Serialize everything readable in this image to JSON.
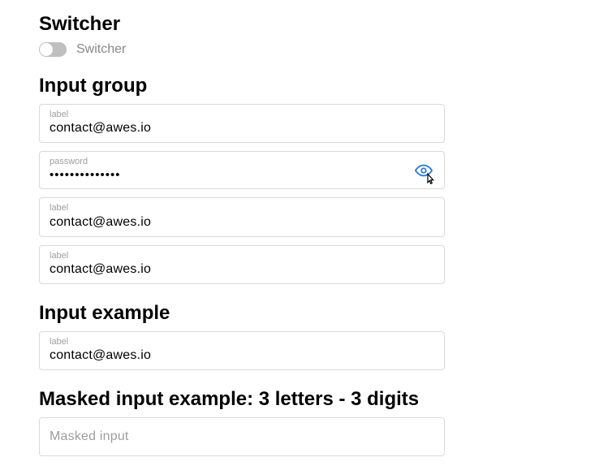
{
  "switcher": {
    "title": "Switcher",
    "label": "Switcher",
    "on": false
  },
  "input_group": {
    "title": "Input group",
    "fields": [
      {
        "label": "label",
        "value": "contact@awes.io"
      },
      {
        "label": "password",
        "value": "••••••••••••••"
      },
      {
        "label": "label",
        "value": "contact@awes.io"
      },
      {
        "label": "label",
        "value": "contact@awes.io"
      }
    ]
  },
  "input_example": {
    "title": "Input example",
    "field": {
      "label": "label",
      "value": "contact@awes.io"
    }
  },
  "masked": {
    "title": "Masked input example: 3 letters - 3 digits",
    "placeholder": "Masked input"
  }
}
